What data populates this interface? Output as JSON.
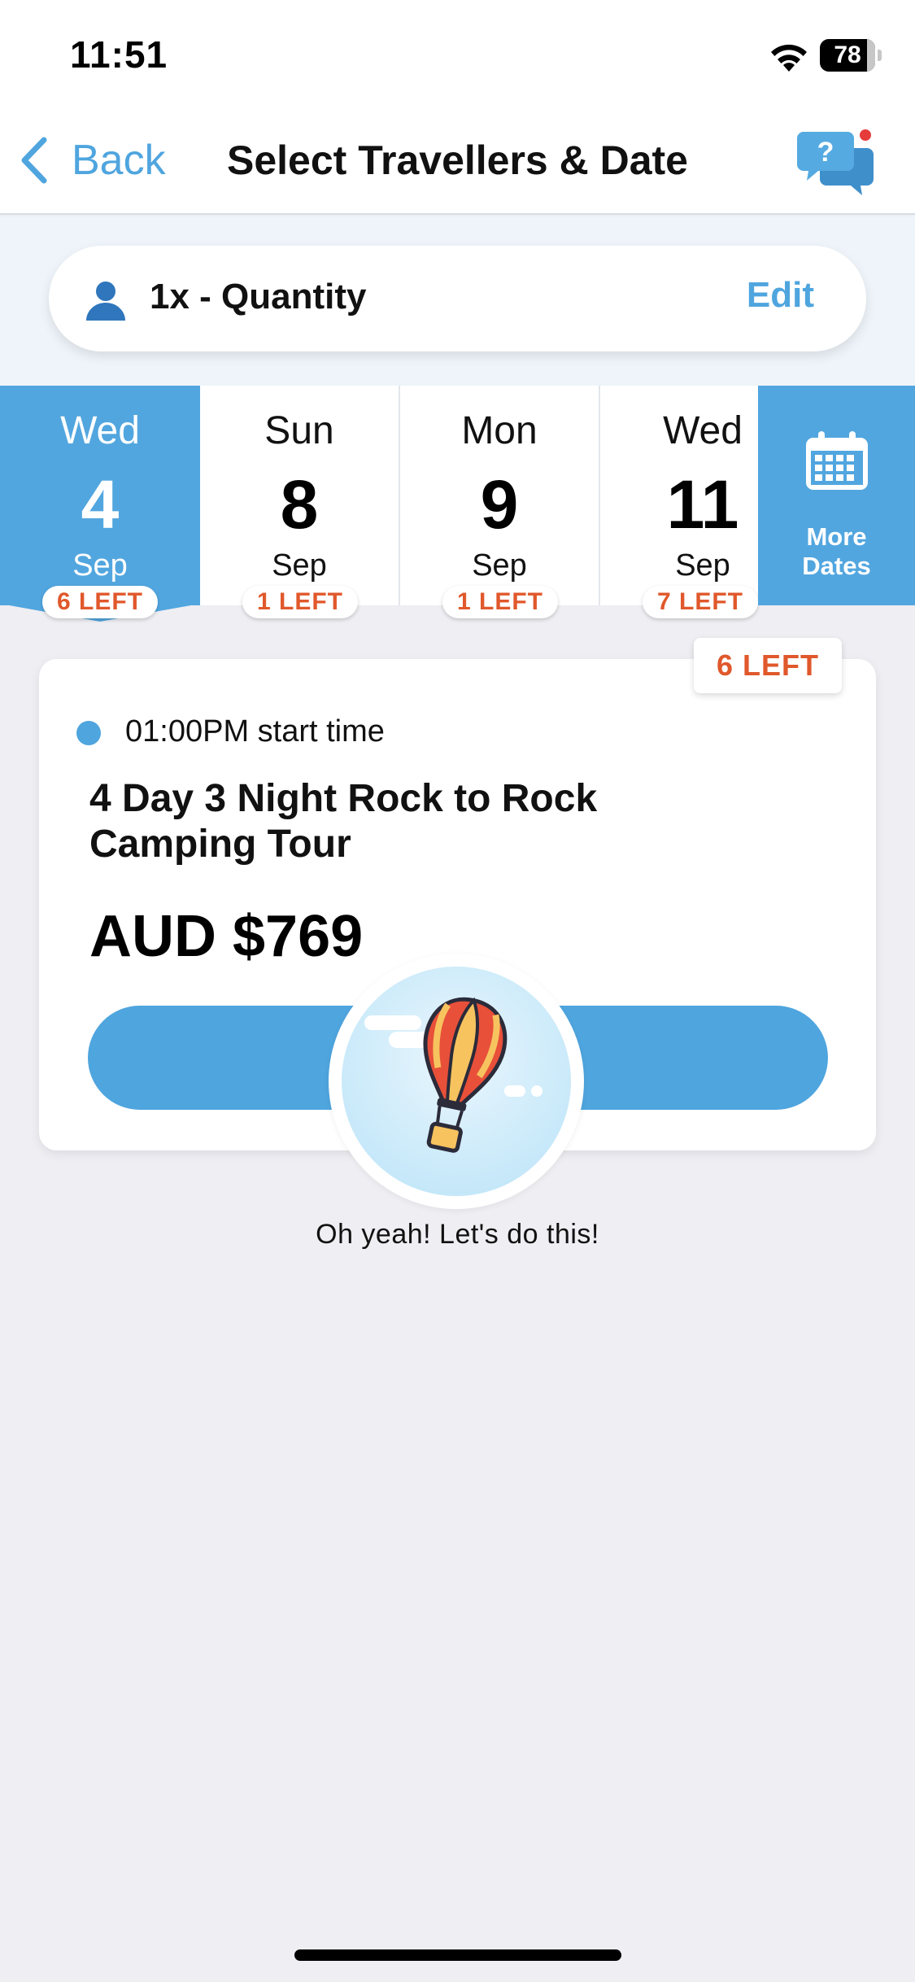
{
  "status_bar": {
    "time": "11:51",
    "battery_level": "78"
  },
  "nav": {
    "back_label": "Back",
    "title": "Select Travellers & Date"
  },
  "quantity": {
    "label": "1x - Quantity",
    "edit_label": "Edit"
  },
  "dates": [
    {
      "dow": "Wed",
      "day": "4",
      "month": "Sep",
      "left": "6 LEFT",
      "selected": true
    },
    {
      "dow": "Sun",
      "day": "8",
      "month": "Sep",
      "left": "1 LEFT",
      "selected": false
    },
    {
      "dow": "Mon",
      "day": "9",
      "month": "Sep",
      "left": "1 LEFT",
      "selected": false
    },
    {
      "dow": "Wed",
      "day": "11",
      "month": "Sep",
      "left": "7 LEFT",
      "selected": false
    }
  ],
  "more_dates": {
    "line1": "More",
    "line2": "Dates"
  },
  "tour": {
    "availability": "6 LEFT",
    "start_time": "01:00PM start time",
    "title": "4 Day 3 Night Rock to Rock Camping Tour",
    "price": "AUD $769"
  },
  "cheer_text": "Oh yeah! Let's do this!",
  "colors": {
    "accent": "#4FA5DE",
    "availability": "#E0582B",
    "background": "#EEEEF3"
  }
}
